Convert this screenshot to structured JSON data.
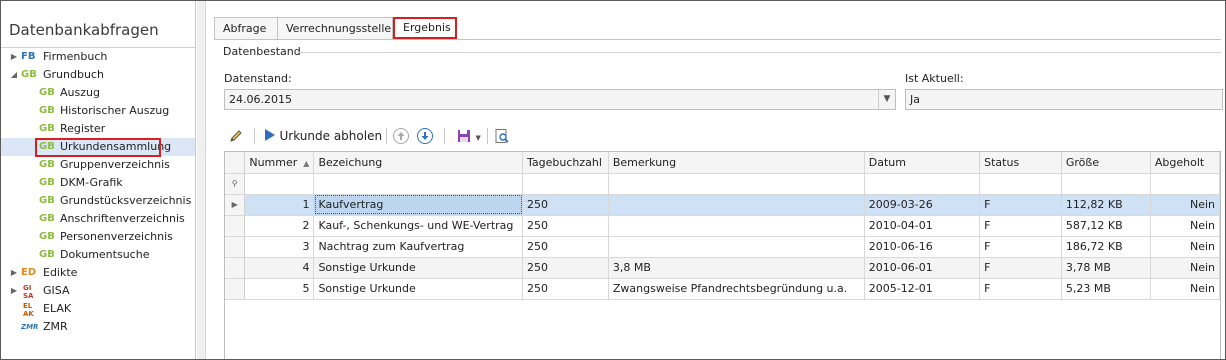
{
  "sidebar": {
    "title": "Datenbankabfragen",
    "items": [
      {
        "code": "FB",
        "label": "Firmenbuch"
      },
      {
        "code": "GB",
        "label": "Grundbuch"
      },
      {
        "code": "GB",
        "label": "Auszug"
      },
      {
        "code": "GB",
        "label": "Historischer Auszug"
      },
      {
        "code": "GB",
        "label": "Register"
      },
      {
        "code": "GB",
        "label": "Urkundensammlung"
      },
      {
        "code": "GB",
        "label": "Gruppenverzeichnis"
      },
      {
        "code": "GB",
        "label": "DKM-Grafik"
      },
      {
        "code": "GB",
        "label": "Grundstücksverzeichnis"
      },
      {
        "code": "GB",
        "label": "Anschriftenverzeichnis"
      },
      {
        "code": "GB",
        "label": "Personenverzeichnis"
      },
      {
        "code": "GB",
        "label": "Dokumentsuche"
      },
      {
        "code": "ED",
        "label": "Edikte"
      },
      {
        "code": "GI SA",
        "label": "GISA"
      },
      {
        "code": "EL AK",
        "label": "ELAK"
      },
      {
        "code": "ZMR",
        "label": "ZMR"
      }
    ]
  },
  "tabs": [
    {
      "label": "Abfrage"
    },
    {
      "label": "Verrechnungsstelle"
    },
    {
      "label": "Ergebnis"
    }
  ],
  "group": {
    "label": "Datenbestand"
  },
  "datenstand": {
    "label": "Datenstand:",
    "value": "24.06.2015"
  },
  "ist_aktuell": {
    "label": "Ist Aktuell:",
    "value": "Ja"
  },
  "toolbar": {
    "urkunde_label": "Urkunde abholen"
  },
  "grid": {
    "columns": [
      "Nummer",
      "Bezeichung",
      "Tagebuchzahl",
      "Bemerkung",
      "Datum",
      "Status",
      "Größe",
      "Abgeholt"
    ],
    "rows": [
      {
        "nummer": "1",
        "bezeichnung": "Kaufvertrag",
        "tagebuchzahl": "250",
        "bemerkung": "",
        "datum": "2009-03-26",
        "status": "F",
        "groesse": "112,82 KB",
        "abgeholt": "Nein"
      },
      {
        "nummer": "2",
        "bezeichnung": "Kauf-, Schenkungs- und WE-Vertrag",
        "tagebuchzahl": "250",
        "bemerkung": "",
        "datum": "2010-04-01",
        "status": "F",
        "groesse": "587,12 KB",
        "abgeholt": "Nein"
      },
      {
        "nummer": "3",
        "bezeichnung": "Nachtrag zum Kaufvertrag",
        "tagebuchzahl": "250",
        "bemerkung": "",
        "datum": "2010-06-16",
        "status": "F",
        "groesse": "186,72 KB",
        "abgeholt": "Nein"
      },
      {
        "nummer": "4",
        "bezeichnung": "Sonstige Urkunde",
        "tagebuchzahl": "250",
        "bemerkung": "3,8 MB",
        "datum": "2010-06-01",
        "status": "F",
        "groesse": "3,78 MB",
        "abgeholt": "Nein"
      },
      {
        "nummer": "5",
        "bezeichnung": "Sonstige Urkunde",
        "tagebuchzahl": "250",
        "bemerkung": "Zwangsweise Pfandrechtsbegründung u.a.",
        "datum": "2005-12-01",
        "status": "F",
        "groesse": "5,23 MB",
        "abgeholt": "Nein"
      }
    ]
  }
}
